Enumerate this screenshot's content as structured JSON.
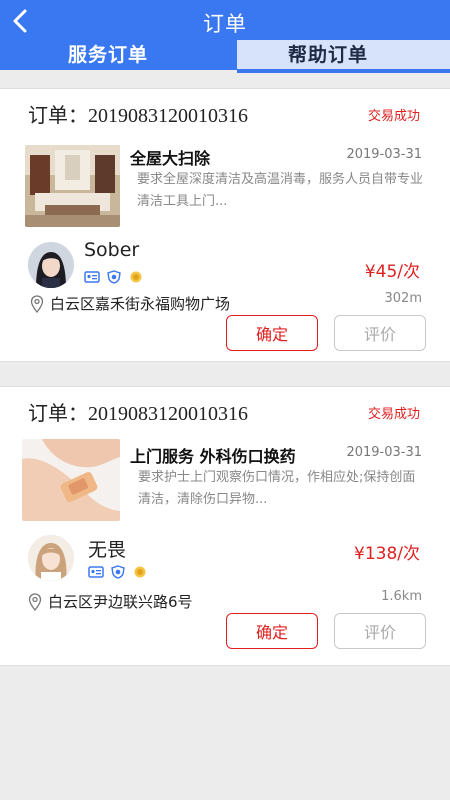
{
  "header": {
    "title": "订单",
    "tabs": [
      {
        "label": "服务订单"
      },
      {
        "label": "帮助订单"
      }
    ]
  },
  "orders": [
    {
      "order_label": "订单：2019083120010316",
      "status": "交易成功",
      "service_name": "全屋大扫除",
      "date": "2019-03-31",
      "description": "要求全屋深度清洁及高温消毒，服务人员自带专业清洁工具上门...",
      "user_name": "Sober",
      "price": "¥45/次",
      "address": "白云区嘉禾街永福购物广场",
      "distance": "302m",
      "confirm_label": "确定",
      "rate_label": "评价"
    },
    {
      "order_label": "订单：2019083120010316",
      "status": "交易成功",
      "service_name": "上门服务 外科伤口换药",
      "date": "2019-03-31",
      "description": "要求护士上门观察伤口情况，作相应处;保持创面清洁，清除伤口异物...",
      "user_name": "无畏",
      "price": "¥138/次",
      "address": "白云区尹边联兴路6号",
      "distance": "1.6km",
      "confirm_label": "确定",
      "rate_label": "评价"
    }
  ],
  "colors": {
    "header_bg": "#3a78f2",
    "price": "#e02020",
    "status": "#e02020"
  }
}
